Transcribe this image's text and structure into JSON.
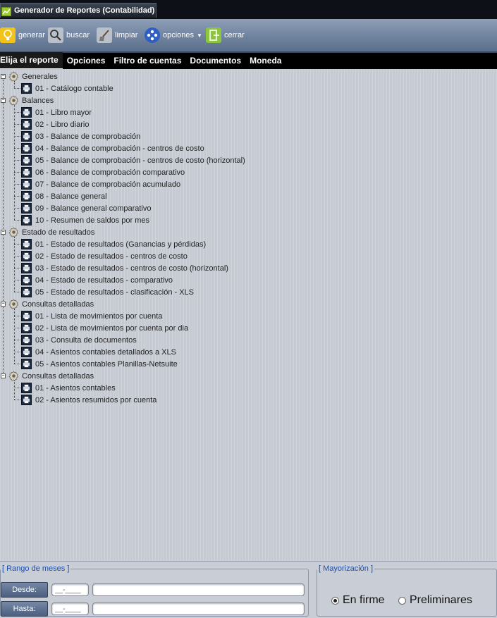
{
  "window": {
    "title": "Generador de Reportes (Contabilidad)"
  },
  "toolbar": {
    "generar": "generar",
    "buscar": "buscar",
    "limpiar": "limpiar",
    "opciones": "opciones",
    "cerrar": "cerrar"
  },
  "tabs": [
    "Elija el reporte",
    "Opciones",
    "Filtro de cuentas",
    "Documentos",
    "Moneda"
  ],
  "tree": [
    {
      "label": "Generales",
      "children": [
        "01 - Catálogo contable"
      ]
    },
    {
      "label": "Balances",
      "children": [
        "01 - Libro mayor",
        "02 - Libro diario",
        "03 - Balance de comprobación",
        "04 - Balance de comprobación - centros de costo",
        "05 - Balance de comprobación - centros de costo (horizontal)",
        "06 - Balance de comprobación comparativo",
        "07 - Balance de comprobación acumulado",
        "08 - Balance general",
        "09 - Balance general comparativo",
        "10 - Resumen de saldos por mes"
      ]
    },
    {
      "label": "Estado de resultados",
      "children": [
        "01 - Estado de resultados (Ganancias y pérdidas)",
        "02 - Estado de resultados - centros de costo",
        "03 - Estado de resultados - centros de costo (horizontal)",
        "04 - Estado de resultados - comparativo",
        "05 - Estado de resultados - clasificación - XLS"
      ]
    },
    {
      "label": "Consultas detalladas",
      "children": [
        "01 - Lista de movimientos por cuenta",
        "02 - Lista de movimientos por cuenta por dia",
        "03 - Consulta de documentos",
        "04 - Asientos contables detallados a XLS",
        "05 - Asientos contables Planillas-Netsuite"
      ]
    },
    {
      "label": "Consultas detalladas",
      "children": [
        "01 - Asientos contables",
        "02 - Asientos resumidos por cuenta"
      ]
    }
  ],
  "range": {
    "legend": "[ Rango de meses ]",
    "desde_label": "Desde:",
    "hasta_label": "Hasta:",
    "desde_mask": "__-____",
    "hasta_mask": "__-____",
    "desde_desc": "",
    "hasta_desc": ""
  },
  "mayorizacion": {
    "legend": "[ Mayorización ]",
    "options": [
      "En firme",
      "Preliminares"
    ],
    "selected": "En firme"
  }
}
